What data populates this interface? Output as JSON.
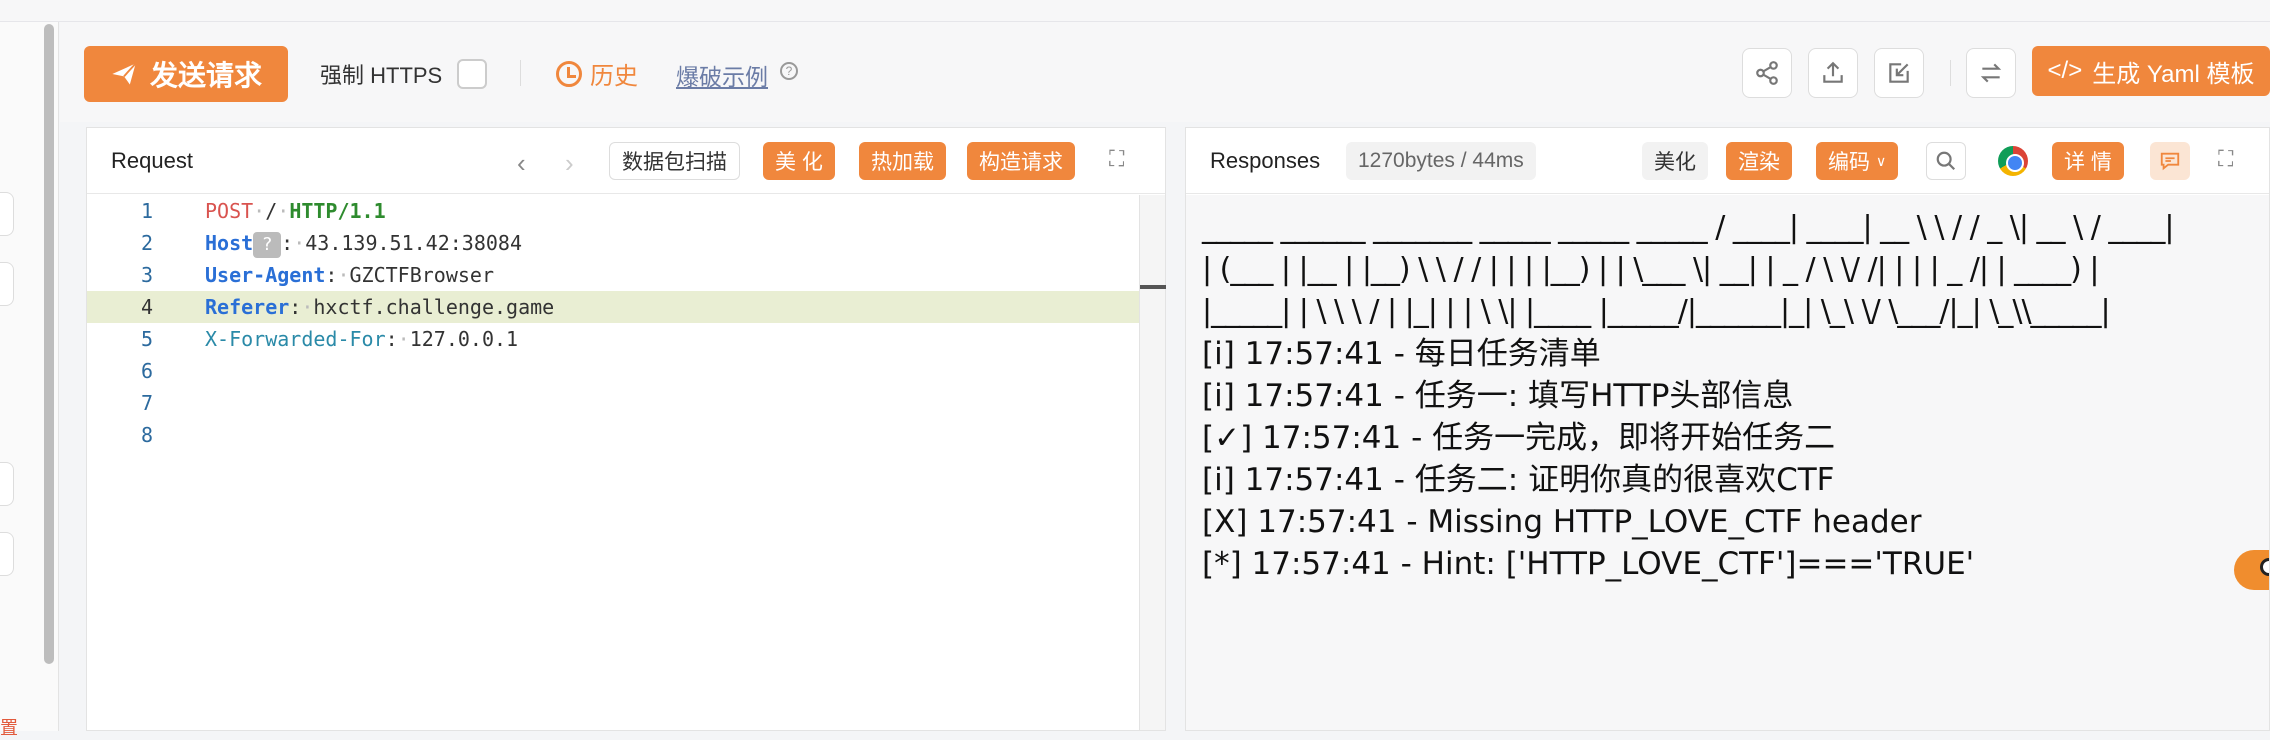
{
  "sidebar": {
    "partial_text": "置"
  },
  "toolbar": {
    "send_label": "发送请求",
    "https_label": "强制 HTTPS",
    "https_checked": false,
    "history_label": "历史",
    "burst_label": "爆破示例",
    "yaml_label": "生成 Yaml 模板",
    "icons": [
      "share-icon",
      "upload-icon",
      "import-icon",
      "swap-icon"
    ]
  },
  "request": {
    "title": "Request",
    "scan_label": "数据包扫描",
    "beautify_label": "美 化",
    "hotload_label": "热加载",
    "construct_label": "构造请求",
    "lines": [
      {
        "num": "1",
        "method": "POST",
        "path": "/",
        "proto": "HTTP/1.1"
      },
      {
        "num": "2",
        "key": "Host",
        "badge": "?",
        "value": "43.139.51.42:38084"
      },
      {
        "num": "3",
        "key": "User-Agent",
        "value": "GZCTFBrowser"
      },
      {
        "num": "4",
        "key": "Referer",
        "value": "hxctf.challenge.game"
      },
      {
        "num": "5",
        "key": "X-Forwarded-For",
        "value": "127.0.0.1"
      },
      {
        "num": "6"
      },
      {
        "num": "7"
      },
      {
        "num": "8"
      }
    ]
  },
  "response": {
    "title": "Responses",
    "meta": "1270bytes / 44ms",
    "beautify_label": "美化",
    "render_label": "渲染",
    "encode_label": "编码",
    "detail_label": "详 情",
    "ascii_lines": [
      " _____ ______ _______ _____ _____ _____ / ____| ____| __ \\ \\ / / _ \\| __ \\ / ____|",
      "| (___ | |__ | |__) \\ \\ / / | | | |__) | | \\___ \\| __| | _ / \\ \\/ /| | | | _ /| | ____) |",
      "|_____| | \\ \\ \\ / | |_| | | \\ \\| |____ |_____/|______|_| \\_\\ \\/ \\___/|_| \\_\\\\_____|"
    ],
    "log_lines": [
      "[i] 17:57:41 - 每日任务清单",
      "[i] 17:57:41 - 任务一: 填写HTTP头部信息",
      "[✓] 17:57:41 - 任务一完成，即将开始任务二",
      "[i] 17:57:41 - 任务二: 证明你真的很喜欢CTF",
      "[X] 17:57:41 - Missing HTTP_LOVE_CTF header",
      "[*] 17:57:41 - Hint: ['HTTP_LOVE_CTF']==='TRUE'"
    ]
  }
}
